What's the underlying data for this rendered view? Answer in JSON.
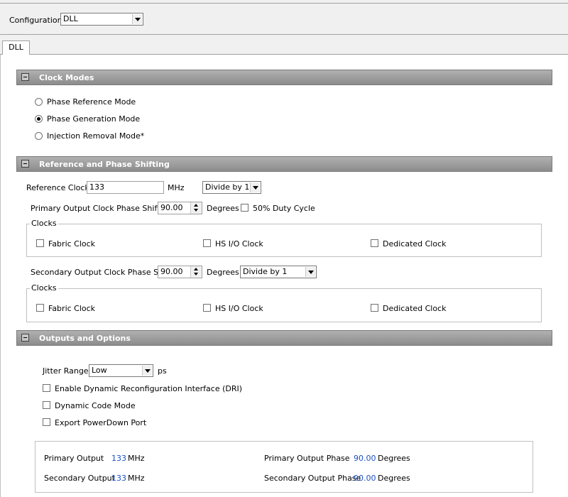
{
  "configuration": {
    "label": "Configuration",
    "value": "DLL"
  },
  "tabs": [
    {
      "label": "DLL"
    }
  ],
  "clock_modes": {
    "title": "Clock Modes",
    "options": [
      {
        "label": "Phase Reference Mode",
        "selected": false
      },
      {
        "label": "Phase Generation Mode",
        "selected": true
      },
      {
        "label": "Injection Removal Mode*",
        "selected": false
      }
    ]
  },
  "reference": {
    "title": "Reference and Phase Shifting",
    "ref_clock_label": "Reference Clock",
    "ref_clock_value": "133",
    "ref_clock_unit": "MHz",
    "divide_value": "Divide by 1",
    "primary_label": "Primary Output Clock Phase Shift",
    "primary_value": "90.00",
    "primary_unit": "Degrees",
    "duty_cycle_label": "50% Duty Cycle",
    "clocks_legend": "Clocks",
    "primary_clocks": [
      "Fabric Clock",
      "HS I/O Clock",
      "Dedicated Clock"
    ],
    "secondary_label": "Secondary Output Clock Phase Shift",
    "secondary_value": "90.00",
    "secondary_unit": "Degrees",
    "secondary_divide": "Divide by 1",
    "secondary_clocks_legend": "Clocks",
    "secondary_clocks": [
      "Fabric Clock",
      "HS I/O Clock",
      "Dedicated Clock"
    ]
  },
  "outputs": {
    "title": "Outputs and Options",
    "jitter_label": "Jitter Range",
    "jitter_value": "Low",
    "jitter_unit": "ps",
    "options": [
      "Enable Dynamic Reconfiguration Interface (DRI)",
      "Dynamic Code Mode",
      "Export PowerDown Port"
    ]
  },
  "summary": {
    "primary_output_label": "Primary Output",
    "primary_output_value": "133",
    "primary_output_unit": "MHz",
    "secondary_output_label": "Secondary Output",
    "secondary_output_value": "133",
    "secondary_output_unit": "MHz",
    "primary_phase_label": "Primary Output Phase",
    "primary_phase_value": "90.00",
    "primary_phase_unit": "Degrees",
    "secondary_phase_label": "Secondary Output Phase",
    "secondary_phase_value": "90.00",
    "secondary_phase_unit": "Degrees"
  },
  "colors": {
    "value_blue": "#1a4fc8",
    "section_header": "#9a9a9a"
  }
}
